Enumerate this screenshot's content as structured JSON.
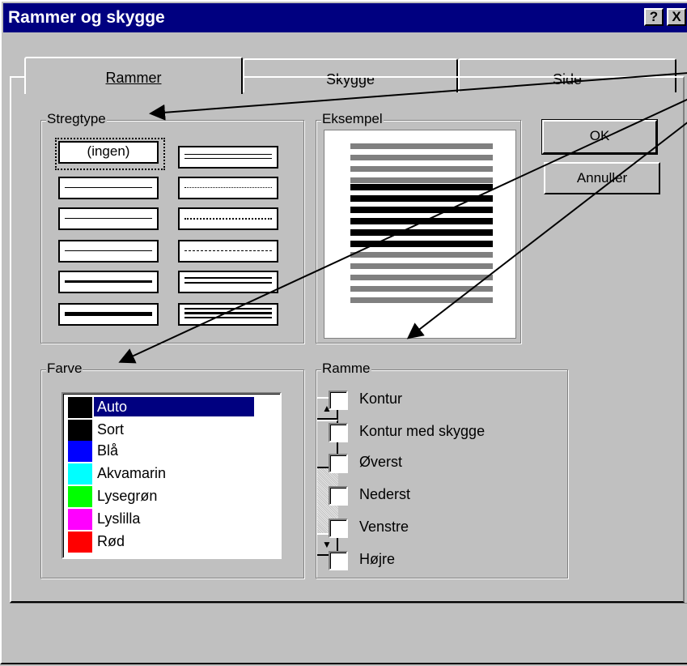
{
  "window": {
    "title": "Rammer og skygge",
    "help_label": "?",
    "close_label": "X"
  },
  "tabs": [
    {
      "label": "Rammer",
      "active": true
    },
    {
      "label": "Skygge",
      "active": false
    },
    {
      "label": "Side",
      "active": false
    }
  ],
  "line_style": {
    "legend": "Stregtype",
    "none_label": "(ingen)",
    "selected": "(ingen)"
  },
  "example": {
    "legend": "Eksempel"
  },
  "buttons": {
    "ok": "OK",
    "cancel": "Annuller"
  },
  "color": {
    "legend": "Farve",
    "items": [
      {
        "label": "Auto",
        "swatch": "#000000",
        "selected": true
      },
      {
        "label": "Sort",
        "swatch": "#000000"
      },
      {
        "label": "Blå",
        "swatch": "#0000ff"
      },
      {
        "label": "Akvamarin",
        "swatch": "#00ffff"
      },
      {
        "label": "Lysegrøn",
        "swatch": "#00ff00"
      },
      {
        "label": "Lyslilla",
        "swatch": "#ff00ff"
      },
      {
        "label": "Rød",
        "swatch": "#ff0000"
      }
    ],
    "scroll_up": "▲",
    "scroll_down": "▼"
  },
  "border": {
    "legend": "Ramme",
    "options": [
      {
        "label": "Kontur",
        "checked": false
      },
      {
        "label": "Kontur med skygge",
        "checked": false
      },
      {
        "label": "Øverst",
        "checked": false
      },
      {
        "label": "Nederst",
        "checked": false
      },
      {
        "label": "Venstre",
        "checked": false
      },
      {
        "label": "Højre",
        "checked": false
      }
    ]
  },
  "colors": {
    "titlebar": "#000080",
    "dialog_bg": "#c0c0c0",
    "preview_dark": "#000000",
    "preview_gray": "#808080"
  }
}
